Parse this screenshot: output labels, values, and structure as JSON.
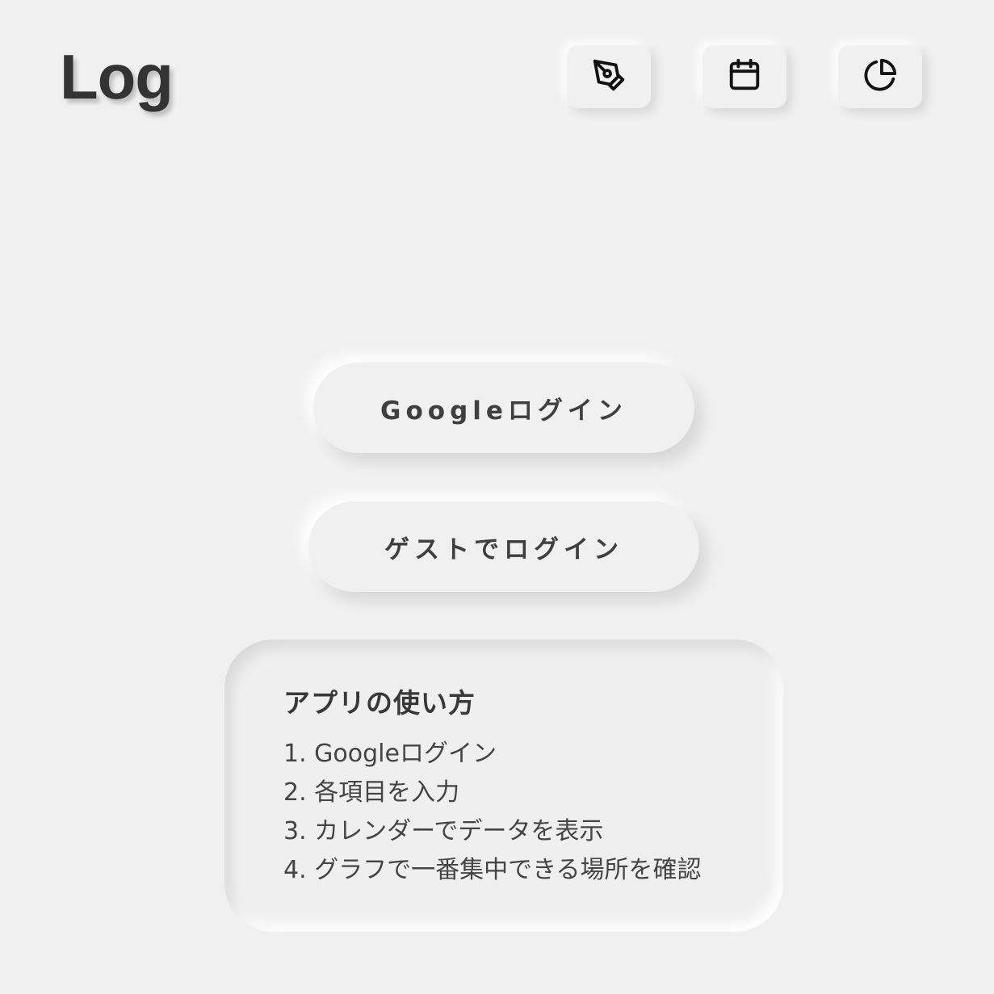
{
  "header": {
    "logo": "Log",
    "icons": [
      {
        "name": "pen-icon",
        "label": "input"
      },
      {
        "name": "calendar-icon",
        "label": "calendar"
      },
      {
        "name": "pie-chart-icon",
        "label": "graph"
      }
    ]
  },
  "login": {
    "google_label": "Googleログイン",
    "guest_label": "ゲストでログイン"
  },
  "howto": {
    "title": "アプリの使い方",
    "steps": [
      "1. Googleログイン",
      "2. 各項目を入力",
      "3. カレンダーでデータを表示",
      "4. グラフで一番集中できる場所を確認"
    ]
  }
}
